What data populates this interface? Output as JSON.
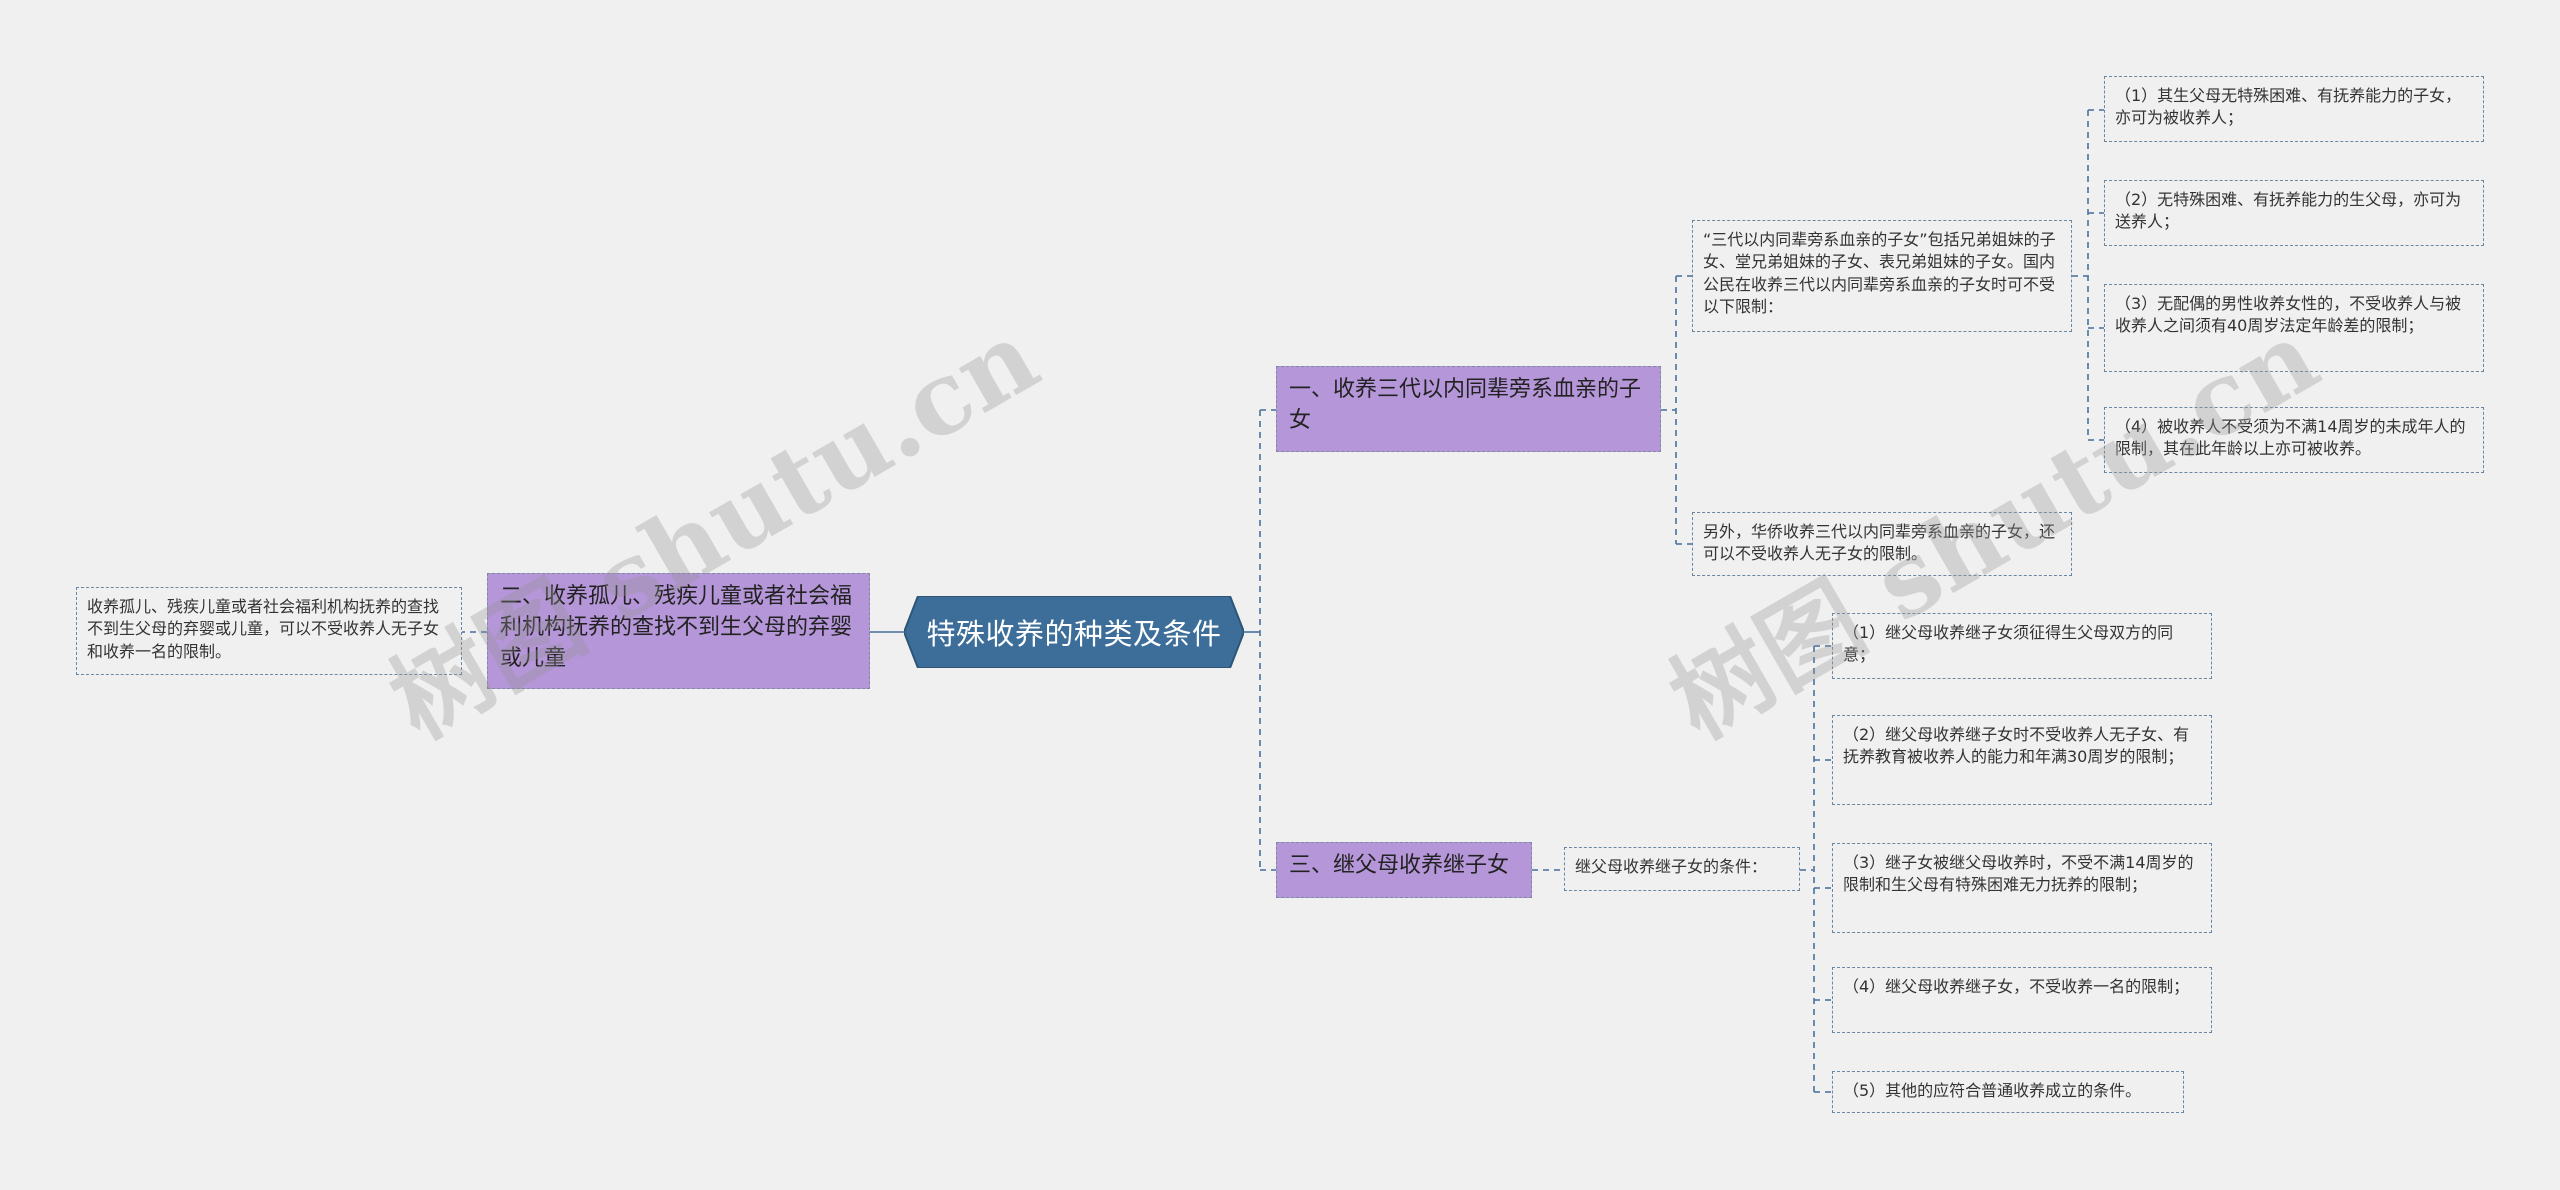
{
  "root": {
    "label": "特殊收养的种类及条件"
  },
  "branches": {
    "b1": {
      "label": "一、收养三代以内同辈旁系血亲的子女"
    },
    "b2": {
      "label": "二、收养孤儿、残疾儿童或者社会福利机构抚养的查找不到生父母的弃婴或儿童"
    },
    "b3": {
      "label": "三、继父母收养继子女"
    }
  },
  "b1_children": {
    "definition": "“三代以内同辈旁系血亲的子女”包括兄弟姐妹的子女、堂兄弟姐妹的子女、表兄弟姐妹的子女。国内公民在收养三代以内同辈旁系血亲的子女时可不受以下限制：",
    "overseas": "另外，华侨收养三代以内同辈旁系血亲的子女，还可以不受收养人无子女的限制。",
    "conditions": [
      "（1）其生父母无特殊困难、有抚养能力的子女，亦可为被收养人；",
      "（2）无特殊困难、有抚养能力的生父母，亦可为送养人；",
      "（3）无配偶的男性收养女性的，不受收养人与被收养人之间须有40周岁法定年龄差的限制；",
      "（4）被收养人不受须为不满14周岁的未成年人的限制，其在此年龄以上亦可被收养。"
    ]
  },
  "b2_children": {
    "note": "收养孤儿、残疾儿童或者社会福利机构抚养的查找不到生父母的弃婴或儿童，可以不受收养人无子女和收养一名的限制。"
  },
  "b3_children": {
    "intro": "继父母收养继子女的条件：",
    "conditions": [
      "（1）继父母收养继子女须征得生父母双方的同意；",
      "（2）继父母收养继子女时不受收养人无子女、有抚养教育被收养人的能力和年满30周岁的限制；",
      "（3）继子女被继父母收养时，不受不满14周岁的限制和生父母有特殊困难无力抚养的限制；",
      "（4）继父母收养继子女，不受收养一名的限制；",
      "（5）其他的应符合普通收养成立的条件。"
    ]
  },
  "watermarks": [
    "树图 shutu.cn",
    "树图 shutu.cn"
  ],
  "colors": {
    "root_fill": "#3d6e9a",
    "branch_fill": "#b596d8",
    "connector": "#5b7fa6",
    "background": "#f0f0f0"
  }
}
